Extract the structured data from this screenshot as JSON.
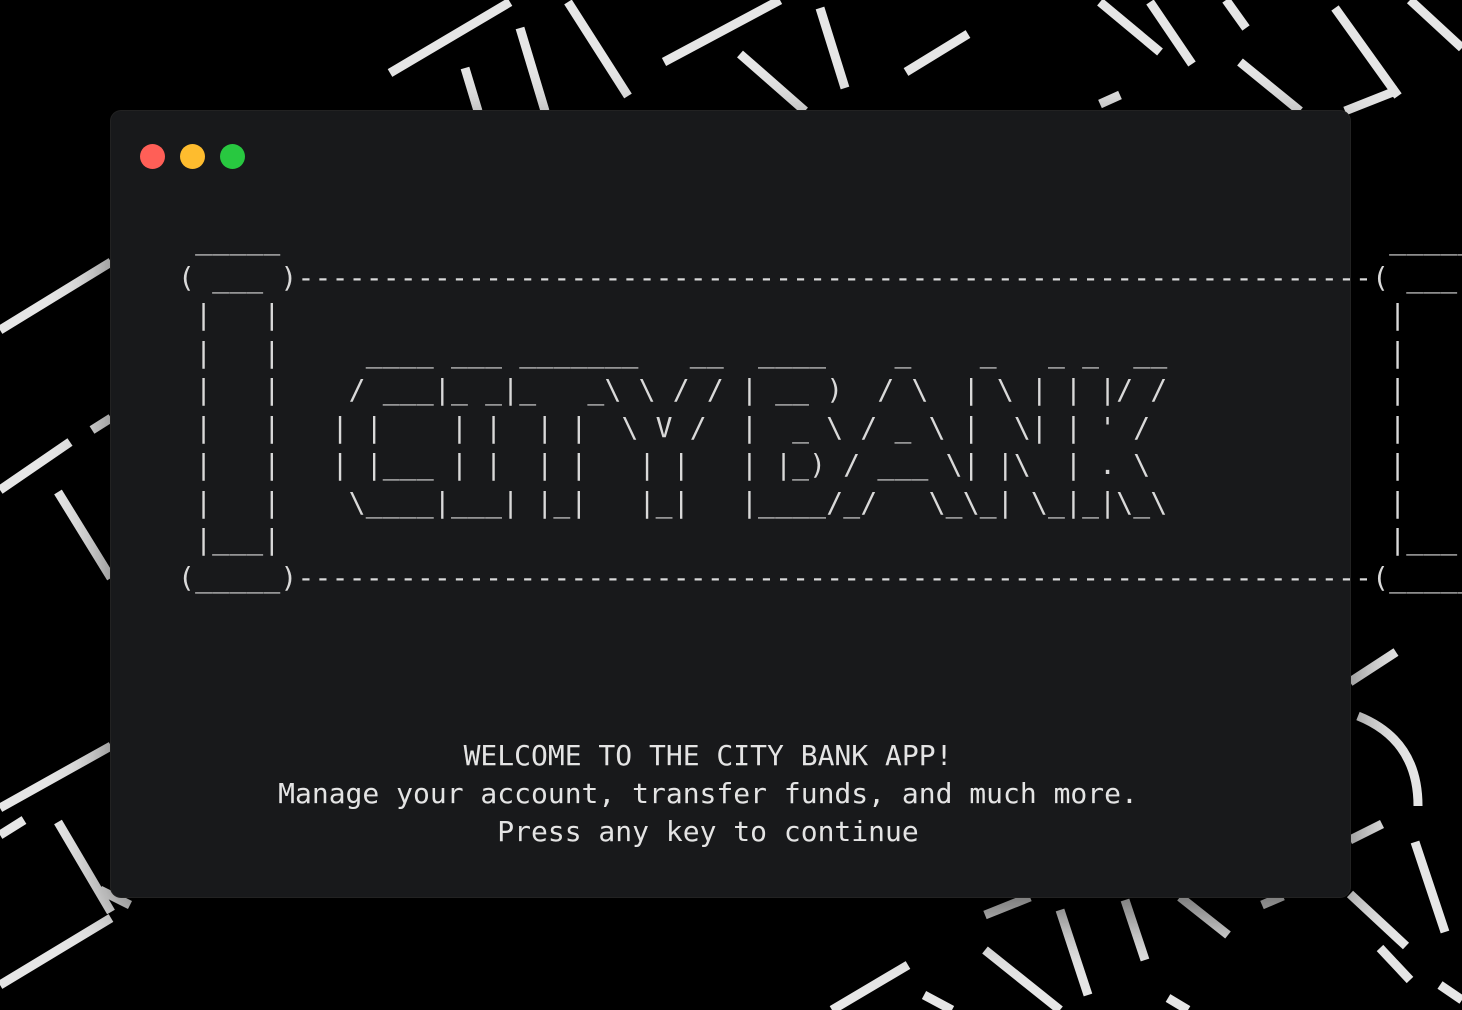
{
  "window": {
    "controls": {
      "close_color": "#ff5f57",
      "minimize_color": "#febc2e",
      "zoom_color": "#28c840"
    }
  },
  "terminal": {
    "banner_ascii": "  _____                                                                 _____\n ( ___ )---------------------------------------------------------------( ___ )\n  |   |                                                                 |   |\n  |   |     ____ ___ _______   __  ____    _    _   _ _  __             |   |\n  |   |    / ___|_ _|_   _\\ \\ / / | __ )  / \\  | \\ | | |/ /             |   |\n  |   |   | |    | |  | |  \\ V /  |  _ \\ / _ \\ |  \\| | ' /              |   |\n  |   |   | |___ | |  | |   | |   | |_) / ___ \\| |\\  | . \\              |   |\n  |   |    \\____|___| |_|   |_|   |____/_/   \\_\\_| \\_|_|\\_\\             |   |\n  |___|                                                                 |___|\n (_____)---------------------------------------------------------------(_____)",
    "welcome": "WELCOME TO THE CITY BANK APP!",
    "tagline": "Manage your account, transfer funds, and much more.",
    "prompt": "Press any key to continue"
  },
  "background": {
    "color": "#000000",
    "stroke_color": "#e6e6e6"
  }
}
